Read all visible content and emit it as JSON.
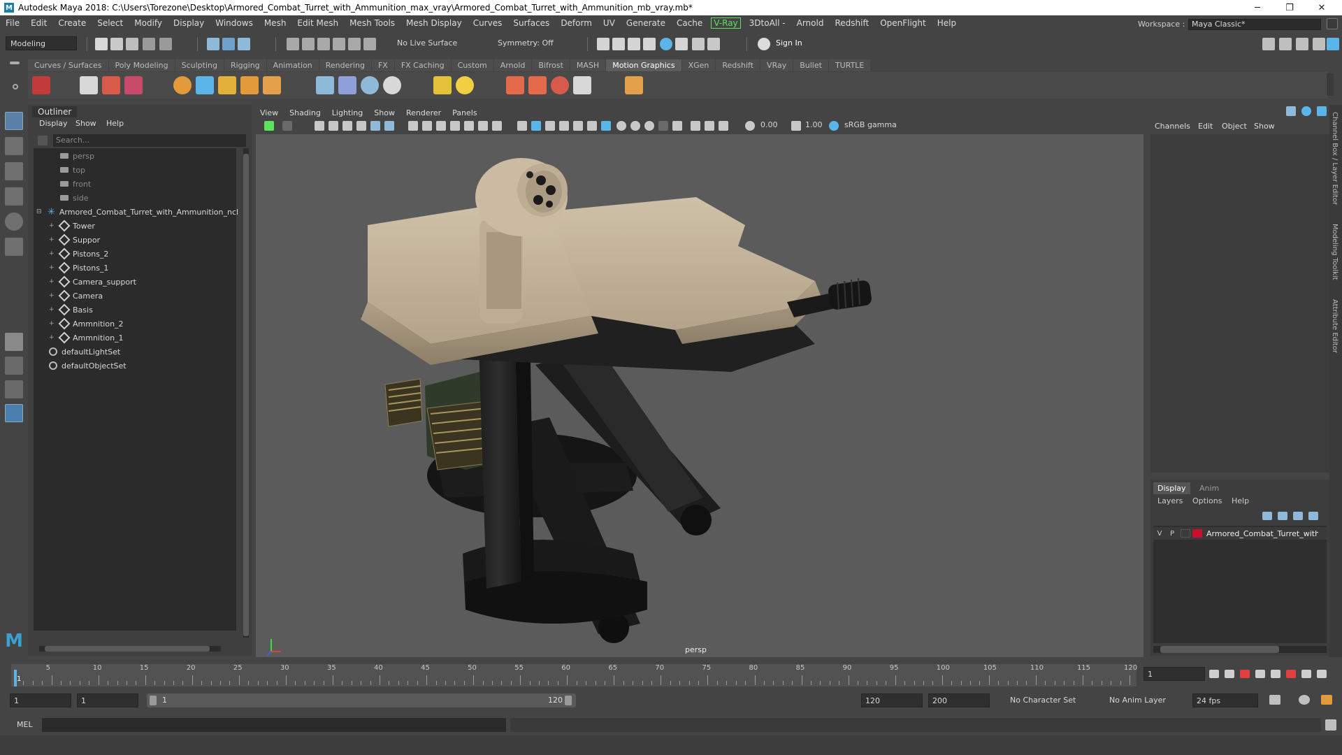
{
  "window": {
    "title": "Autodesk Maya 2018: C:\\Users\\Torezone\\Desktop\\Armored_Combat_Turret_with_Ammunition_max_vray\\Armored_Combat_Turret_with_Ammunition_mb_vray.mb*",
    "minimize": "─",
    "restore": "❐",
    "close": "✕"
  },
  "menubar": {
    "items": [
      "File",
      "Edit",
      "Create",
      "Select",
      "Modify",
      "Display",
      "Windows",
      "Mesh",
      "Edit Mesh",
      "Mesh Tools",
      "Mesh Display",
      "Curves",
      "Surfaces",
      "Deform",
      "UV",
      "Generate",
      "Cache"
    ],
    "vray": "V-Ray",
    "items2": [
      "3DtoAll -",
      "Arnold",
      "Redshift",
      "OpenFlight",
      "Help"
    ],
    "workspace_label": "Workspace :",
    "workspace_value": "Maya Classic*"
  },
  "statusline": {
    "mode": "Modeling",
    "live_surface": "No Live Surface",
    "symmetry": "Symmetry: Off",
    "sign_in": "Sign In"
  },
  "shelf": {
    "tabs": [
      "Curves / Surfaces",
      "Poly Modeling",
      "Sculpting",
      "Rigging",
      "Animation",
      "Rendering",
      "FX",
      "FX Caching",
      "Custom",
      "Arnold",
      "Bifrost",
      "MASH",
      "Motion Graphics",
      "XGen",
      "Redshift",
      "VRay",
      "Bullet",
      "TURTLE"
    ],
    "active_tab": "Motion Graphics"
  },
  "outliner": {
    "title": "Outliner",
    "menu": [
      "Display",
      "Show",
      "Help"
    ],
    "search_placeholder": "Search...",
    "cameras": [
      "persp",
      "top",
      "front",
      "side"
    ],
    "group": "Armored_Combat_Turret_with_Ammunition_ncl",
    "children": [
      "Tower",
      "Suppor",
      "Pistons_2",
      "Pistons_1",
      "Camera_support",
      "Camera",
      "Basis",
      "Ammnition_2",
      "Ammnition_1"
    ],
    "sets": [
      "defaultLightSet",
      "defaultObjectSet"
    ]
  },
  "viewport": {
    "menu": [
      "View",
      "Shading",
      "Lighting",
      "Show",
      "Renderer",
      "Panels"
    ],
    "exposure": "0.00",
    "gamma": "1.00",
    "color_space": "sRGB gamma",
    "camera_label": "persp"
  },
  "channelbox": {
    "menu": [
      "Channels",
      "Edit",
      "Object",
      "Show"
    ]
  },
  "layer_editor": {
    "tabs": [
      "Display",
      "Anim"
    ],
    "menu": [
      "Layers",
      "Options",
      "Help"
    ],
    "layer_v": "V",
    "layer_p": "P",
    "layer_name": "Armored_Combat_Turret_with_",
    "layer_color": "#c8102e"
  },
  "side_tabs": [
    "Channel Box / Layer Editor",
    "Modeling Toolkit",
    "Attribute Editor"
  ],
  "timeline": {
    "ticks": [
      "5",
      "10",
      "15",
      "20",
      "25",
      "30",
      "35",
      "40",
      "45",
      "50",
      "55",
      "60",
      "65",
      "70",
      "75",
      "80",
      "85",
      "90",
      "95",
      "100",
      "105",
      "110",
      "115",
      "120"
    ],
    "start_marker": "1",
    "current_frame": "1"
  },
  "range": {
    "start": "1",
    "anim_start": "1",
    "range_start": "1",
    "range_end": "120",
    "anim_end": "120",
    "end": "200",
    "character_set": "No Character Set",
    "anim_layer": "No Anim Layer",
    "fps": "24 fps"
  },
  "cmdline": {
    "label": "MEL"
  },
  "colors": {
    "accent": "#5bb5e8",
    "vray_green": "#5fe35f",
    "turret_tan": "#c2b29a",
    "viewport_bg": "#5b5b5b"
  }
}
